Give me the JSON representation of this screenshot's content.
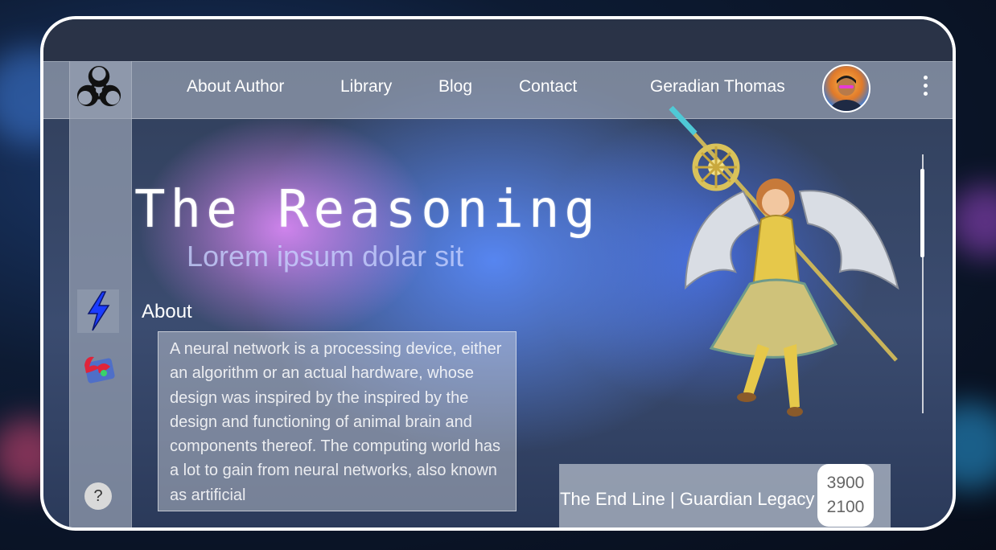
{
  "nav": {
    "items": [
      "About Author",
      "Library",
      "Blog",
      "Contact"
    ],
    "user_name": "Geradian Thomas"
  },
  "hero": {
    "title": "The Reasoning",
    "subtitle": "Lorem ipsum dolar sit"
  },
  "about": {
    "label": "About",
    "text": "A neural network is a processing device, either an algorithm or an actual hardware, whose design was inspired by the inspired by the design and functioning of animal brain and components thereof. The computing world has a lot to gain from neural networks, also known as artificial"
  },
  "sidebar": {
    "icons": [
      "biohazard-icon",
      "lightning-icon",
      "app-logo-icon",
      "help-icon"
    ],
    "help_label": "?"
  },
  "card": {
    "title": "The End Line | Guardian Legacy",
    "stat_1": "3900",
    "stat_2": "2100"
  },
  "colors": {
    "frame_border": "#ffffff",
    "accent_lightning": "#1a3cff",
    "glass": "#96a0b2"
  }
}
